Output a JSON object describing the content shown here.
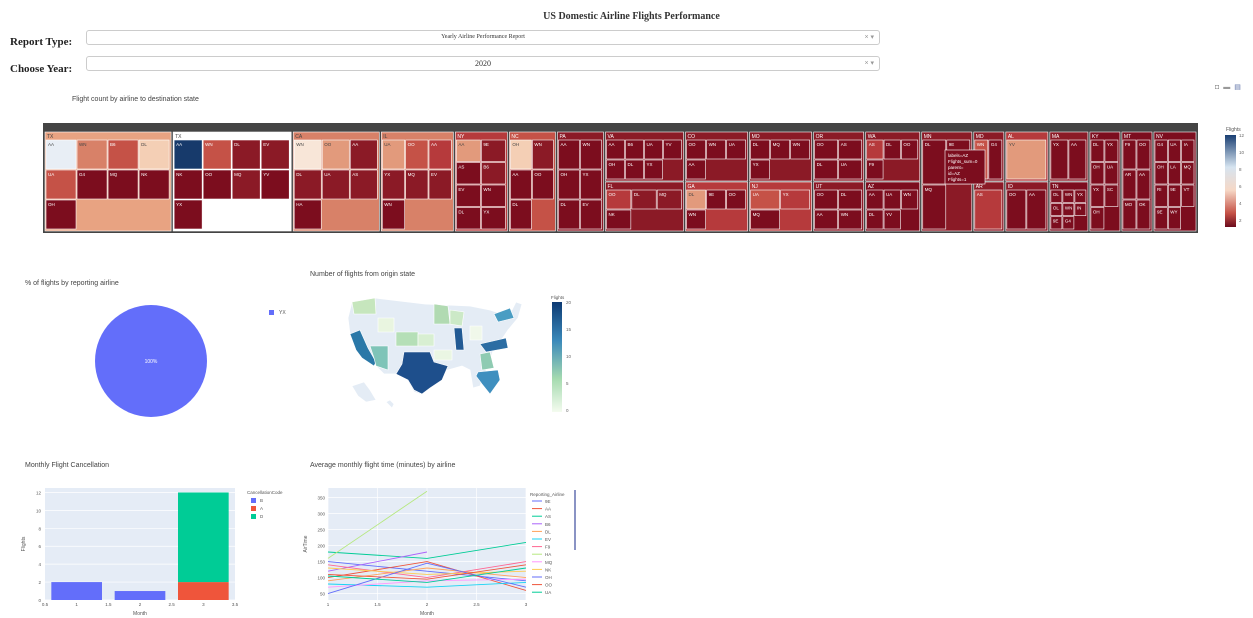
{
  "header": {
    "title": "US Domestic Airline Flights Performance"
  },
  "controls": {
    "report_type_label": "Report Type:",
    "report_type_value": "Yearly Airline Performance Report",
    "year_label": "Choose Year:",
    "year_value": "2020",
    "clear_glyph": "× ▾"
  },
  "modebar": {
    "icons": [
      "camera-icon",
      "zoom-icon",
      "chart-icon"
    ]
  },
  "treemap": {
    "title": "Flight count by airline to destination state",
    "colorbar_title": "Flights",
    "colorbar_ticks": [
      "12",
      "10",
      "8",
      "6",
      "4",
      "2"
    ],
    "hover": [
      "labels=AZ",
      "Flights_sum=0",
      "parent=",
      "id=AZ",
      "Flights=1"
    ],
    "states": [
      {
        "label": "TX",
        "color": "#e8a382",
        "children": [
          {
            "label": "AA",
            "color": "#e8eef5"
          },
          {
            "label": "WN",
            "color": "#d88168"
          },
          {
            "label": "B6",
            "color": "#c55247"
          },
          {
            "label": "DL",
            "color": "#f4cfb5"
          },
          {
            "label": "UA",
            "color": "#c55247"
          },
          {
            "label": "G4",
            "color": "#7c0d1e"
          },
          {
            "label": "MQ",
            "color": "#7c0d1e"
          },
          {
            "label": "NK",
            "color": "#7c0d1e"
          },
          {
            "label": "OH",
            "color": "#7c0d1e"
          }
        ]
      },
      {
        "label": "TX",
        "color": "#ffffff",
        "children": [
          {
            "label": "AA",
            "color": "#173a6b"
          },
          {
            "label": "WN",
            "color": "#c55247"
          },
          {
            "label": "DL",
            "color": "#8b1a26"
          },
          {
            "label": "EV",
            "color": "#8b1a26"
          },
          {
            "label": "NK",
            "color": "#7c0d1e"
          },
          {
            "label": "OO",
            "color": "#7c0d1e"
          },
          {
            "label": "MQ",
            "color": "#8b1a26"
          },
          {
            "label": "YV",
            "color": "#7c0d1e"
          },
          {
            "label": "YX",
            "color": "#7c0d1e"
          }
        ]
      },
      {
        "label": "CA",
        "color": "#d88168",
        "children": [
          {
            "label": "WN",
            "color": "#f8e6d8"
          },
          {
            "label": "OO",
            "color": "#e29a7c"
          },
          {
            "label": "AA",
            "color": "#8b1a26"
          },
          {
            "label": "DL",
            "color": "#8b1a26"
          },
          {
            "label": "UA",
            "color": "#8b1a26"
          },
          {
            "label": "AS",
            "color": "#8b1a26"
          },
          {
            "label": "HA",
            "color": "#7c0d1e"
          }
        ]
      },
      {
        "label": "IL",
        "color": "#d88168",
        "children": [
          {
            "label": "UA",
            "color": "#e29a7c"
          },
          {
            "label": "OO",
            "color": "#c55247"
          },
          {
            "label": "AA",
            "color": "#b63a3c"
          },
          {
            "label": "YX",
            "color": "#8b1a26"
          },
          {
            "label": "MQ",
            "color": "#8b1a26"
          },
          {
            "label": "EV",
            "color": "#8b1a26"
          },
          {
            "label": "WN",
            "color": "#7c0d1e"
          }
        ]
      },
      {
        "label": "NY",
        "color": "#b63a3c",
        "children": [
          {
            "label": "AA",
            "color": "#e29a7c"
          },
          {
            "label": "9E",
            "color": "#8b1a26"
          },
          {
            "label": "AS",
            "color": "#7c0d1e"
          },
          {
            "label": "B6",
            "color": "#8b1a26"
          },
          {
            "label": "EV",
            "color": "#7c0d1e"
          },
          {
            "label": "WN",
            "color": "#7c0d1e"
          },
          {
            "label": "DL",
            "color": "#7c0d1e"
          },
          {
            "label": "YX",
            "color": "#7c0d1e"
          }
        ]
      },
      {
        "label": "NC",
        "color": "#c55247",
        "children": [
          {
            "label": "OH",
            "color": "#f4cfb5"
          },
          {
            "label": "WN",
            "color": "#8b1a26"
          },
          {
            "label": "AA",
            "color": "#7c0d1e"
          },
          {
            "label": "OO",
            "color": "#7c0d1e"
          },
          {
            "label": "DL",
            "color": "#7c0d1e"
          }
        ]
      },
      {
        "label": "PA",
        "color": "#8b1a26",
        "children": [
          {
            "label": "AA",
            "color": "#7c0d1e"
          },
          {
            "label": "WN",
            "color": "#7c0d1e"
          },
          {
            "label": "OH",
            "color": "#7c0d1e"
          },
          {
            "label": "YX",
            "color": "#7c0d1e"
          },
          {
            "label": "DL",
            "color": "#7c0d1e"
          },
          {
            "label": "EV",
            "color": "#7c0d1e"
          }
        ]
      },
      {
        "label": "VA",
        "color": "#8b1a26",
        "children": [
          {
            "label": "AA",
            "color": "#7c0d1e"
          },
          {
            "label": "B6",
            "color": "#7c0d1e"
          },
          {
            "label": "UA",
            "color": "#7c0d1e"
          },
          {
            "label": "YV",
            "color": "#7c0d1e"
          },
          {
            "label": "OH",
            "color": "#7c0d1e"
          },
          {
            "label": "DL",
            "color": "#7c0d1e"
          },
          {
            "label": "YX",
            "color": "#7c0d1e"
          }
        ]
      },
      {
        "label": "FL",
        "color": "#8b1a26",
        "children": [
          {
            "label": "OO",
            "color": "#b63a3c"
          },
          {
            "label": "DL",
            "color": "#8b1a26"
          },
          {
            "label": "MQ",
            "color": "#8b1a26"
          },
          {
            "label": "NK",
            "color": "#7c0d1e"
          }
        ]
      },
      {
        "label": "CO",
        "color": "#8b1a26",
        "children": [
          {
            "label": "OO",
            "color": "#7c0d1e"
          },
          {
            "label": "WN",
            "color": "#7c0d1e"
          },
          {
            "label": "UA",
            "color": "#7c0d1e"
          },
          {
            "label": "AA",
            "color": "#7c0d1e"
          }
        ]
      },
      {
        "label": "GA",
        "color": "#b63a3c",
        "children": [
          {
            "label": "DL",
            "color": "#e29a7c"
          },
          {
            "label": "9E",
            "color": "#7c0d1e"
          },
          {
            "label": "OO",
            "color": "#7c0d1e"
          },
          {
            "label": "WN",
            "color": "#7c0d1e"
          }
        ]
      },
      {
        "label": "MO",
        "color": "#8b1a26",
        "children": [
          {
            "label": "DL",
            "color": "#7c0d1e"
          },
          {
            "label": "MQ",
            "color": "#7c0d1e"
          },
          {
            "label": "WN",
            "color": "#7c0d1e"
          },
          {
            "label": "YX",
            "color": "#7c0d1e"
          }
        ]
      },
      {
        "label": "NJ",
        "color": "#b63a3c",
        "children": [
          {
            "label": "UA",
            "color": "#c55247"
          },
          {
            "label": "YX",
            "color": "#b63a3c"
          },
          {
            "label": "MQ",
            "color": "#7c0d1e"
          }
        ]
      },
      {
        "label": "OR",
        "color": "#8b1a26",
        "children": [
          {
            "label": "OO",
            "color": "#7c0d1e"
          },
          {
            "label": "AS",
            "color": "#7c0d1e"
          },
          {
            "label": "DL",
            "color": "#7c0d1e"
          },
          {
            "label": "UA",
            "color": "#7c0d1e"
          }
        ]
      },
      {
        "label": "UT",
        "color": "#8b1a26",
        "children": [
          {
            "label": "OO",
            "color": "#7c0d1e"
          },
          {
            "label": "DL",
            "color": "#7c0d1e"
          },
          {
            "label": "AA",
            "color": "#7c0d1e"
          },
          {
            "label": "WN",
            "color": "#7c0d1e"
          }
        ]
      },
      {
        "label": "WA",
        "color": "#8b1a26",
        "children": [
          {
            "label": "AS",
            "color": "#b63a3c"
          },
          {
            "label": "DL",
            "color": "#7c0d1e"
          },
          {
            "label": "OO",
            "color": "#7c0d1e"
          },
          {
            "label": "F9",
            "color": "#7c0d1e"
          }
        ]
      },
      {
        "label": "AZ",
        "color": "#7c0d1e",
        "children": [
          {
            "label": "AA",
            "color": "#7c0d1e"
          },
          {
            "label": "UA",
            "color": "#7c0d1e"
          },
          {
            "label": "WN",
            "color": "#7c0d1e"
          },
          {
            "label": "DL",
            "color": "#7c0d1e"
          },
          {
            "label": "YV",
            "color": "#7c0d1e"
          }
        ]
      },
      {
        "label": "MN",
        "color": "#8b1a26",
        "children": [
          {
            "label": "DL",
            "color": "#7c0d1e"
          },
          {
            "label": "9E",
            "color": "#7c0d1e"
          },
          {
            "label": "MQ",
            "color": "#7c0d1e"
          }
        ]
      },
      {
        "label": "MD",
        "color": "#8b1a26",
        "children": [
          {
            "label": "WN",
            "color": "#c55247"
          },
          {
            "label": "G4",
            "color": "#7c0d1e"
          }
        ]
      },
      {
        "label": "AR",
        "color": "#8b1a26",
        "children": [
          {
            "label": "AS",
            "color": "#b63a3c"
          }
        ]
      },
      {
        "label": "AL",
        "color": "#b63a3c",
        "children": [
          {
            "label": "YV",
            "color": "#e29a7c"
          }
        ]
      },
      {
        "label": "ID",
        "color": "#8b1a26",
        "children": [
          {
            "label": "OO",
            "color": "#7c0d1e"
          },
          {
            "label": "AA",
            "color": "#7c0d1e"
          }
        ]
      },
      {
        "label": "MA",
        "color": "#8b1a26",
        "children": [
          {
            "label": "YX",
            "color": "#7c0d1e"
          },
          {
            "label": "AA",
            "color": "#7c0d1e"
          }
        ]
      },
      {
        "label": "TN",
        "color": "#7c0d1e",
        "children": [
          {
            "label": "OL",
            "color": "#7c0d1e"
          },
          {
            "label": "WN",
            "color": "#7c0d1e"
          },
          {
            "label": "YX",
            "color": "#7c0d1e"
          },
          {
            "label": "OL",
            "color": "#7c0d1e"
          },
          {
            "label": "WN",
            "color": "#7c0d1e"
          },
          {
            "label": "IN",
            "color": "#7c0d1e"
          },
          {
            "label": "9E",
            "color": "#7c0d1e"
          },
          {
            "label": "G4",
            "color": "#7c0d1e"
          }
        ]
      },
      {
        "label": "KY",
        "color": "#7c0d1e",
        "children": [
          {
            "label": "DL",
            "color": "#7c0d1e"
          },
          {
            "label": "YX",
            "color": "#7c0d1e"
          },
          {
            "label": "OH",
            "color": "#7c0d1e"
          },
          {
            "label": "UA",
            "color": "#7c0d1e"
          },
          {
            "label": "YX",
            "color": "#7c0d1e"
          },
          {
            "label": "SC",
            "color": "#7c0d1e"
          },
          {
            "label": "OH",
            "color": "#7c0d1e"
          }
        ]
      },
      {
        "label": "MT",
        "color": "#7c0d1e",
        "children": [
          {
            "label": "F9",
            "color": "#7c0d1e"
          },
          {
            "label": "OO",
            "color": "#7c0d1e"
          },
          {
            "label": "AR",
            "color": "#7c0d1e"
          },
          {
            "label": "AA",
            "color": "#7c0d1e"
          },
          {
            "label": "MO",
            "color": "#7c0d1e"
          },
          {
            "label": "OK",
            "color": "#7c0d1e"
          }
        ]
      },
      {
        "label": "NV",
        "color": "#7c0d1e",
        "children": [
          {
            "label": "G4",
            "color": "#7c0d1e"
          },
          {
            "label": "UA",
            "color": "#7c0d1e"
          },
          {
            "label": "IA",
            "color": "#7c0d1e"
          },
          {
            "label": "OH",
            "color": "#7c0d1e"
          },
          {
            "label": "LA",
            "color": "#7c0d1e"
          },
          {
            "label": "MQ",
            "color": "#7c0d1e"
          },
          {
            "label": "RI",
            "color": "#7c0d1e"
          },
          {
            "label": "9E",
            "color": "#7c0d1e"
          },
          {
            "label": "VT",
            "color": "#7c0d1e"
          },
          {
            "label": "9E",
            "color": "#7c0d1e"
          },
          {
            "label": "WY",
            "color": "#7c0d1e"
          }
        ]
      }
    ]
  },
  "pie": {
    "title": "% of flights by reporting airline",
    "slice_label": "100%",
    "legend": [
      {
        "label": "YX",
        "color": "#636efa"
      }
    ],
    "chart_data": {
      "type": "pie",
      "labels": [
        "YX"
      ],
      "values": [
        100
      ]
    }
  },
  "map": {
    "title": "Number of flights from origin state",
    "colorbar_title": "Flights",
    "colorbar_ticks": [
      "20",
      "15",
      "10",
      "5",
      "0"
    ],
    "highlights": [
      {
        "state": "TX",
        "color": "#1e4f8c"
      },
      {
        "state": "CA",
        "color": "#2a78a8"
      },
      {
        "state": "FL",
        "color": "#3f8fbf"
      },
      {
        "state": "NC",
        "color": "#2c6da3"
      },
      {
        "state": "IL",
        "color": "#225a94"
      },
      {
        "state": "NY",
        "color": "#4a9dc3"
      },
      {
        "state": "AZ",
        "color": "#7fc4b8"
      },
      {
        "state": "GA",
        "color": "#8fcbb2"
      },
      {
        "state": "CO",
        "color": "#b5dfb7"
      },
      {
        "state": "WA",
        "color": "#c6e6bd"
      },
      {
        "state": "MN",
        "color": "#b1dab2"
      }
    ]
  },
  "bars": {
    "title": "Monthly Flight Cancellation",
    "chart_data": {
      "type": "bar",
      "categories": [
        1,
        2,
        3
      ],
      "series": [
        {
          "name": "B",
          "color": "#636efa",
          "values": [
            2,
            1,
            0
          ]
        },
        {
          "name": "A",
          "color": "#ef553b",
          "values": [
            0,
            0,
            2
          ]
        },
        {
          "name": "D",
          "color": "#00cc96",
          "values": [
            0,
            0,
            10
          ]
        }
      ],
      "legend_title": "CancellationCode",
      "xlabel": "Month",
      "ylabel": "Flights",
      "ylim": [
        0,
        12.5
      ],
      "xlim": [
        0.5,
        3.5
      ],
      "yticks": [
        0,
        2,
        4,
        6,
        8,
        10,
        12
      ],
      "xticks": [
        0.5,
        1,
        1.5,
        2,
        2.5,
        3,
        3.5
      ]
    }
  },
  "lines": {
    "title": "Average monthly flight time (minutes) by airline",
    "chart_data": {
      "type": "line",
      "x": [
        1,
        2,
        3
      ],
      "xlabel": "Month",
      "ylabel": "AirTime",
      "ylim": [
        30,
        380
      ],
      "xlim": [
        1,
        3
      ],
      "yticks": [
        50,
        100,
        150,
        200,
        250,
        300,
        350
      ],
      "xticks": [
        1,
        1.5,
        2,
        2.5,
        3
      ],
      "legend_title": "Reporting_Airline",
      "series": [
        {
          "name": "9E",
          "color": "#636efa",
          "values": [
            150,
            120,
            90
          ]
        },
        {
          "name": "AA",
          "color": "#ef553b",
          "values": [
            100,
            150,
            60
          ]
        },
        {
          "name": "AS",
          "color": "#00cc96",
          "values": [
            180,
            160,
            210
          ]
        },
        {
          "name": "B6",
          "color": "#ab63fa",
          "values": [
            120,
            180,
            null
          ]
        },
        {
          "name": "DL",
          "color": "#ffa15a",
          "values": [
            90,
            130,
            100
          ]
        },
        {
          "name": "EV",
          "color": "#19d3f3",
          "values": [
            80,
            70,
            85
          ]
        },
        {
          "name": "F9",
          "color": "#ff6692",
          "values": [
            140,
            100,
            150
          ]
        },
        {
          "name": "HA",
          "color": "#b6e880",
          "values": [
            160,
            370,
            null
          ]
        },
        {
          "name": "MQ",
          "color": "#ff97ff",
          "values": [
            70,
            90,
            95
          ]
        },
        {
          "name": "NK",
          "color": "#fecb52",
          "values": [
            130,
            110,
            120
          ]
        },
        {
          "name": "OH",
          "color": "#636efa",
          "values": [
            50,
            145,
            70
          ]
        },
        {
          "name": "OO",
          "color": "#ef553b",
          "values": [
            110,
            95,
            140
          ]
        },
        {
          "name": "UA",
          "color": "#00cc96",
          "values": [
            105,
            85,
            130
          ]
        }
      ]
    }
  }
}
